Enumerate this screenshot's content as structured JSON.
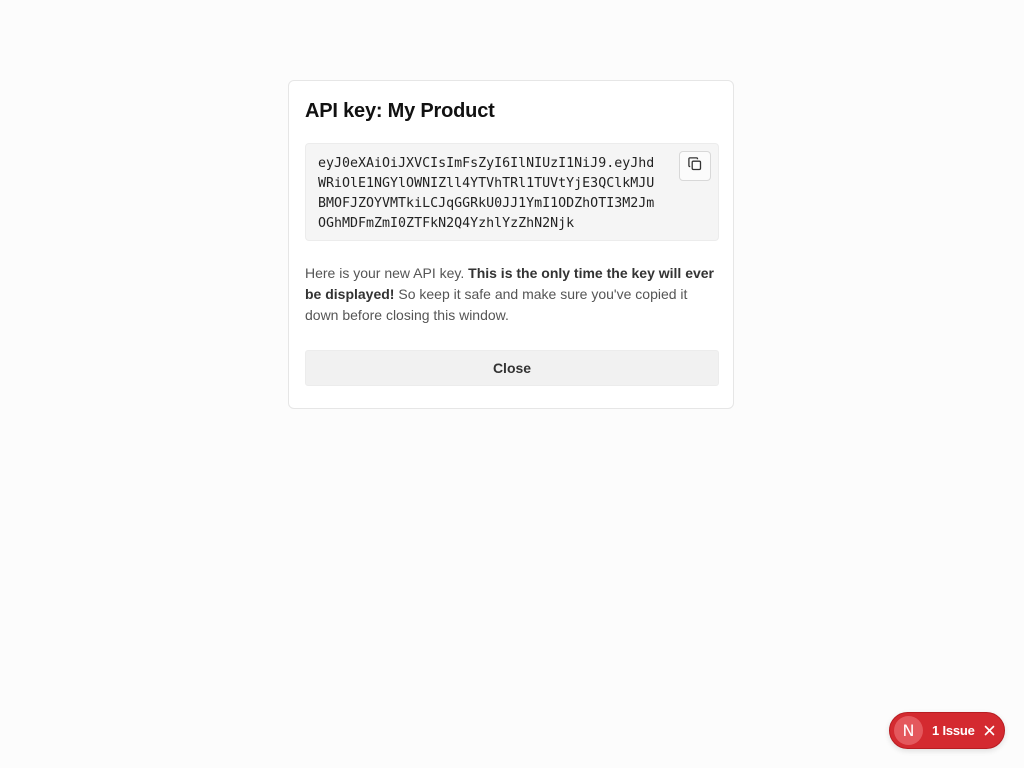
{
  "modal": {
    "title": "API key: My Product",
    "api_key": "eyJ0eXAiOiJXVCIsImFsZyI6IlNIUzI1NiJ9.eyJhdWRiOlE1NGYlOWNIZll4YTVhTRl1TUVtYjE3QClkMJUBMOFJZOYVMTkiLCJqGGRkU0JJ1YmI1ODZhOTI3M2JmOGhMDFmZmI0ZTFkN2Q4YzhlYzZhN2Njk",
    "copy_icon": "copy-icon",
    "description_prefix": "Here is your new API key. ",
    "description_bold": "This is the only time the key will ever be displayed!",
    "description_suffix": " So keep it safe and make sure you've copied it down before closing this window.",
    "close_label": "Close"
  },
  "dev_overlay": {
    "logo_letter": "N",
    "issue_label": "1 Issue",
    "close_icon": "close-icon",
    "badge_color": "#d42a30"
  }
}
